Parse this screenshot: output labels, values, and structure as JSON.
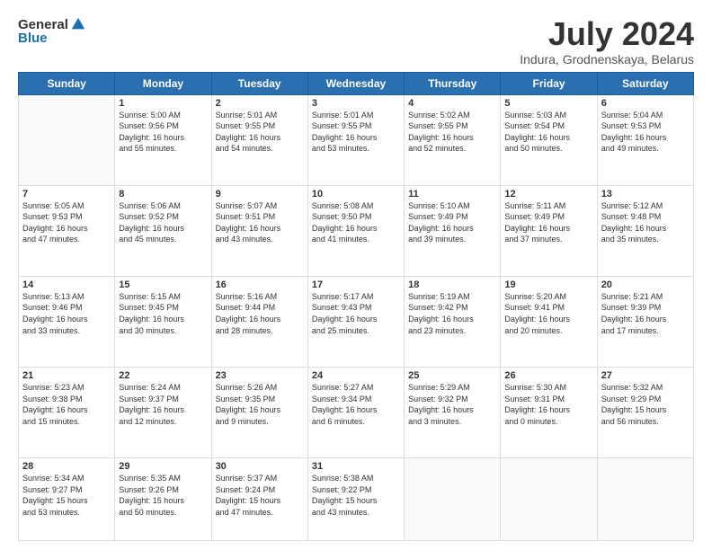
{
  "header": {
    "logo_general": "General",
    "logo_blue": "Blue",
    "month_title": "July 2024",
    "subtitle": "Indura, Grodnenskaya, Belarus"
  },
  "weekdays": [
    "Sunday",
    "Monday",
    "Tuesday",
    "Wednesday",
    "Thursday",
    "Friday",
    "Saturday"
  ],
  "weeks": [
    [
      {
        "day": "",
        "info": ""
      },
      {
        "day": "1",
        "info": "Sunrise: 5:00 AM\nSunset: 9:56 PM\nDaylight: 16 hours\nand 55 minutes."
      },
      {
        "day": "2",
        "info": "Sunrise: 5:01 AM\nSunset: 9:55 PM\nDaylight: 16 hours\nand 54 minutes."
      },
      {
        "day": "3",
        "info": "Sunrise: 5:01 AM\nSunset: 9:55 PM\nDaylight: 16 hours\nand 53 minutes."
      },
      {
        "day": "4",
        "info": "Sunrise: 5:02 AM\nSunset: 9:55 PM\nDaylight: 16 hours\nand 52 minutes."
      },
      {
        "day": "5",
        "info": "Sunrise: 5:03 AM\nSunset: 9:54 PM\nDaylight: 16 hours\nand 50 minutes."
      },
      {
        "day": "6",
        "info": "Sunrise: 5:04 AM\nSunset: 9:53 PM\nDaylight: 16 hours\nand 49 minutes."
      }
    ],
    [
      {
        "day": "7",
        "info": "Sunrise: 5:05 AM\nSunset: 9:53 PM\nDaylight: 16 hours\nand 47 minutes."
      },
      {
        "day": "8",
        "info": "Sunrise: 5:06 AM\nSunset: 9:52 PM\nDaylight: 16 hours\nand 45 minutes."
      },
      {
        "day": "9",
        "info": "Sunrise: 5:07 AM\nSunset: 9:51 PM\nDaylight: 16 hours\nand 43 minutes."
      },
      {
        "day": "10",
        "info": "Sunrise: 5:08 AM\nSunset: 9:50 PM\nDaylight: 16 hours\nand 41 minutes."
      },
      {
        "day": "11",
        "info": "Sunrise: 5:10 AM\nSunset: 9:49 PM\nDaylight: 16 hours\nand 39 minutes."
      },
      {
        "day": "12",
        "info": "Sunrise: 5:11 AM\nSunset: 9:49 PM\nDaylight: 16 hours\nand 37 minutes."
      },
      {
        "day": "13",
        "info": "Sunrise: 5:12 AM\nSunset: 9:48 PM\nDaylight: 16 hours\nand 35 minutes."
      }
    ],
    [
      {
        "day": "14",
        "info": "Sunrise: 5:13 AM\nSunset: 9:46 PM\nDaylight: 16 hours\nand 33 minutes."
      },
      {
        "day": "15",
        "info": "Sunrise: 5:15 AM\nSunset: 9:45 PM\nDaylight: 16 hours\nand 30 minutes."
      },
      {
        "day": "16",
        "info": "Sunrise: 5:16 AM\nSunset: 9:44 PM\nDaylight: 16 hours\nand 28 minutes."
      },
      {
        "day": "17",
        "info": "Sunrise: 5:17 AM\nSunset: 9:43 PM\nDaylight: 16 hours\nand 25 minutes."
      },
      {
        "day": "18",
        "info": "Sunrise: 5:19 AM\nSunset: 9:42 PM\nDaylight: 16 hours\nand 23 minutes."
      },
      {
        "day": "19",
        "info": "Sunrise: 5:20 AM\nSunset: 9:41 PM\nDaylight: 16 hours\nand 20 minutes."
      },
      {
        "day": "20",
        "info": "Sunrise: 5:21 AM\nSunset: 9:39 PM\nDaylight: 16 hours\nand 17 minutes."
      }
    ],
    [
      {
        "day": "21",
        "info": "Sunrise: 5:23 AM\nSunset: 9:38 PM\nDaylight: 16 hours\nand 15 minutes."
      },
      {
        "day": "22",
        "info": "Sunrise: 5:24 AM\nSunset: 9:37 PM\nDaylight: 16 hours\nand 12 minutes."
      },
      {
        "day": "23",
        "info": "Sunrise: 5:26 AM\nSunset: 9:35 PM\nDaylight: 16 hours\nand 9 minutes."
      },
      {
        "day": "24",
        "info": "Sunrise: 5:27 AM\nSunset: 9:34 PM\nDaylight: 16 hours\nand 6 minutes."
      },
      {
        "day": "25",
        "info": "Sunrise: 5:29 AM\nSunset: 9:32 PM\nDaylight: 16 hours\nand 3 minutes."
      },
      {
        "day": "26",
        "info": "Sunrise: 5:30 AM\nSunset: 9:31 PM\nDaylight: 16 hours\nand 0 minutes."
      },
      {
        "day": "27",
        "info": "Sunrise: 5:32 AM\nSunset: 9:29 PM\nDaylight: 15 hours\nand 56 minutes."
      }
    ],
    [
      {
        "day": "28",
        "info": "Sunrise: 5:34 AM\nSunset: 9:27 PM\nDaylight: 15 hours\nand 53 minutes."
      },
      {
        "day": "29",
        "info": "Sunrise: 5:35 AM\nSunset: 9:26 PM\nDaylight: 15 hours\nand 50 minutes."
      },
      {
        "day": "30",
        "info": "Sunrise: 5:37 AM\nSunset: 9:24 PM\nDaylight: 15 hours\nand 47 minutes."
      },
      {
        "day": "31",
        "info": "Sunrise: 5:38 AM\nSunset: 9:22 PM\nDaylight: 15 hours\nand 43 minutes."
      },
      {
        "day": "",
        "info": ""
      },
      {
        "day": "",
        "info": ""
      },
      {
        "day": "",
        "info": ""
      }
    ]
  ]
}
